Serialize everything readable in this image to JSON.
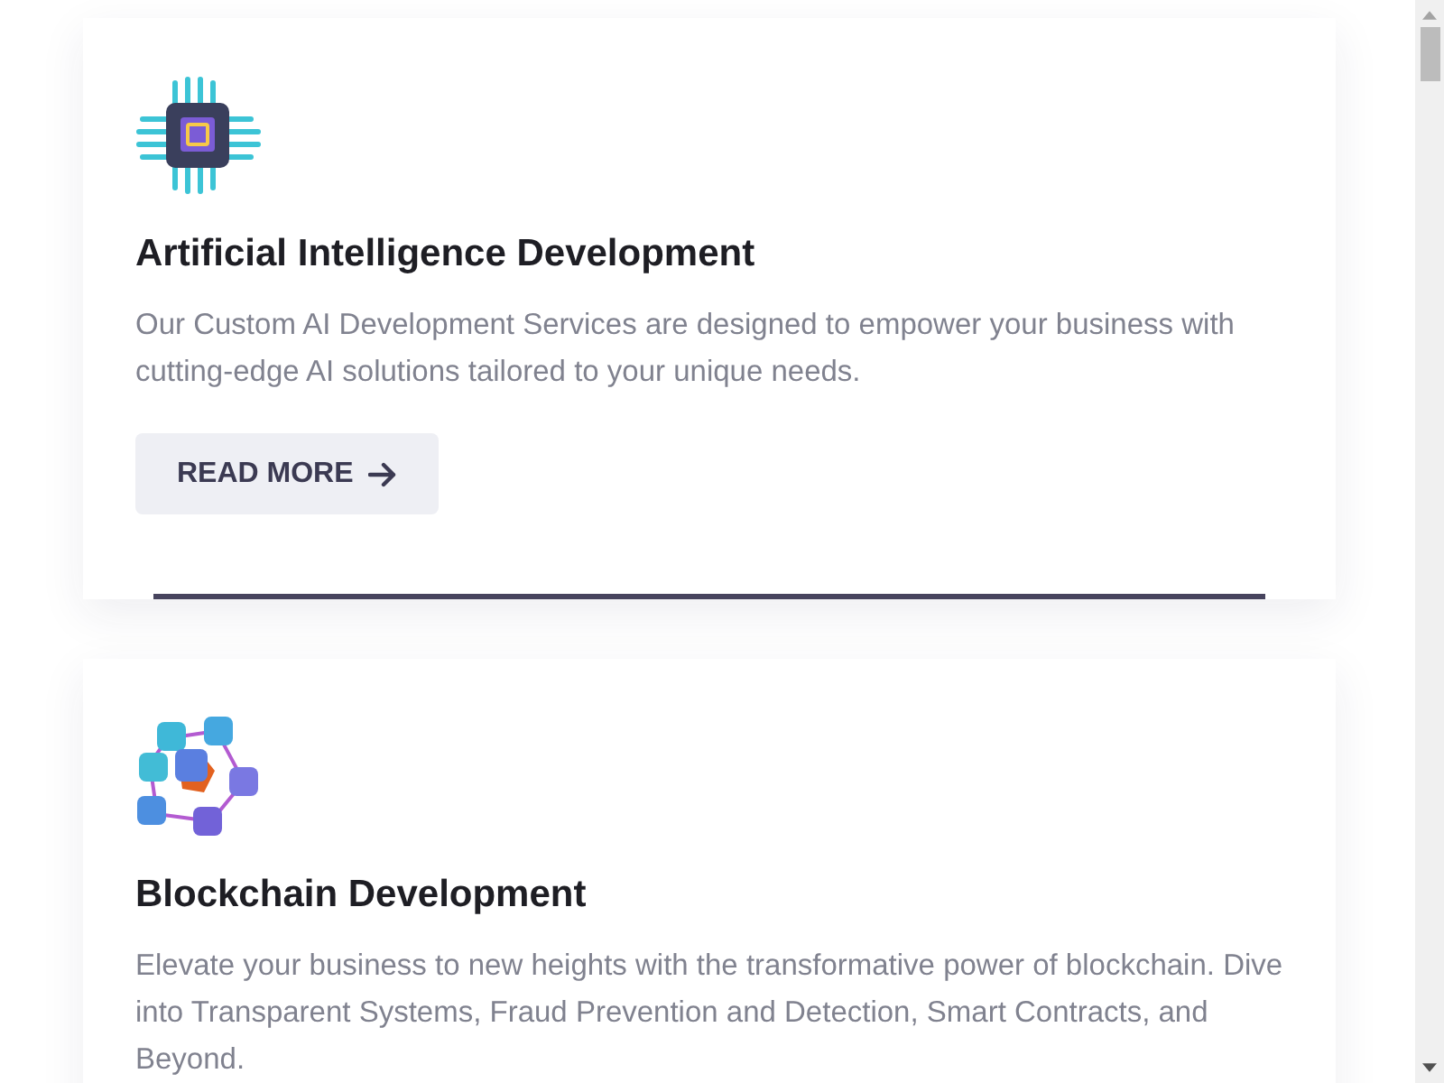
{
  "cards": [
    {
      "title": "Artificial Intelligence Development",
      "description": "Our Custom AI Development Services are designed to empower your business with cutting-edge AI solutions tailored to your unique needs.",
      "button": "READ MORE",
      "highlighted": true
    },
    {
      "title": "Blockchain Development",
      "description": "Elevate your business to new heights with the transformative power of blockchain. Dive into Transparent Systems, Fraud Prevention and Detection, Smart Contracts, and Beyond.",
      "highlighted": false
    }
  ]
}
